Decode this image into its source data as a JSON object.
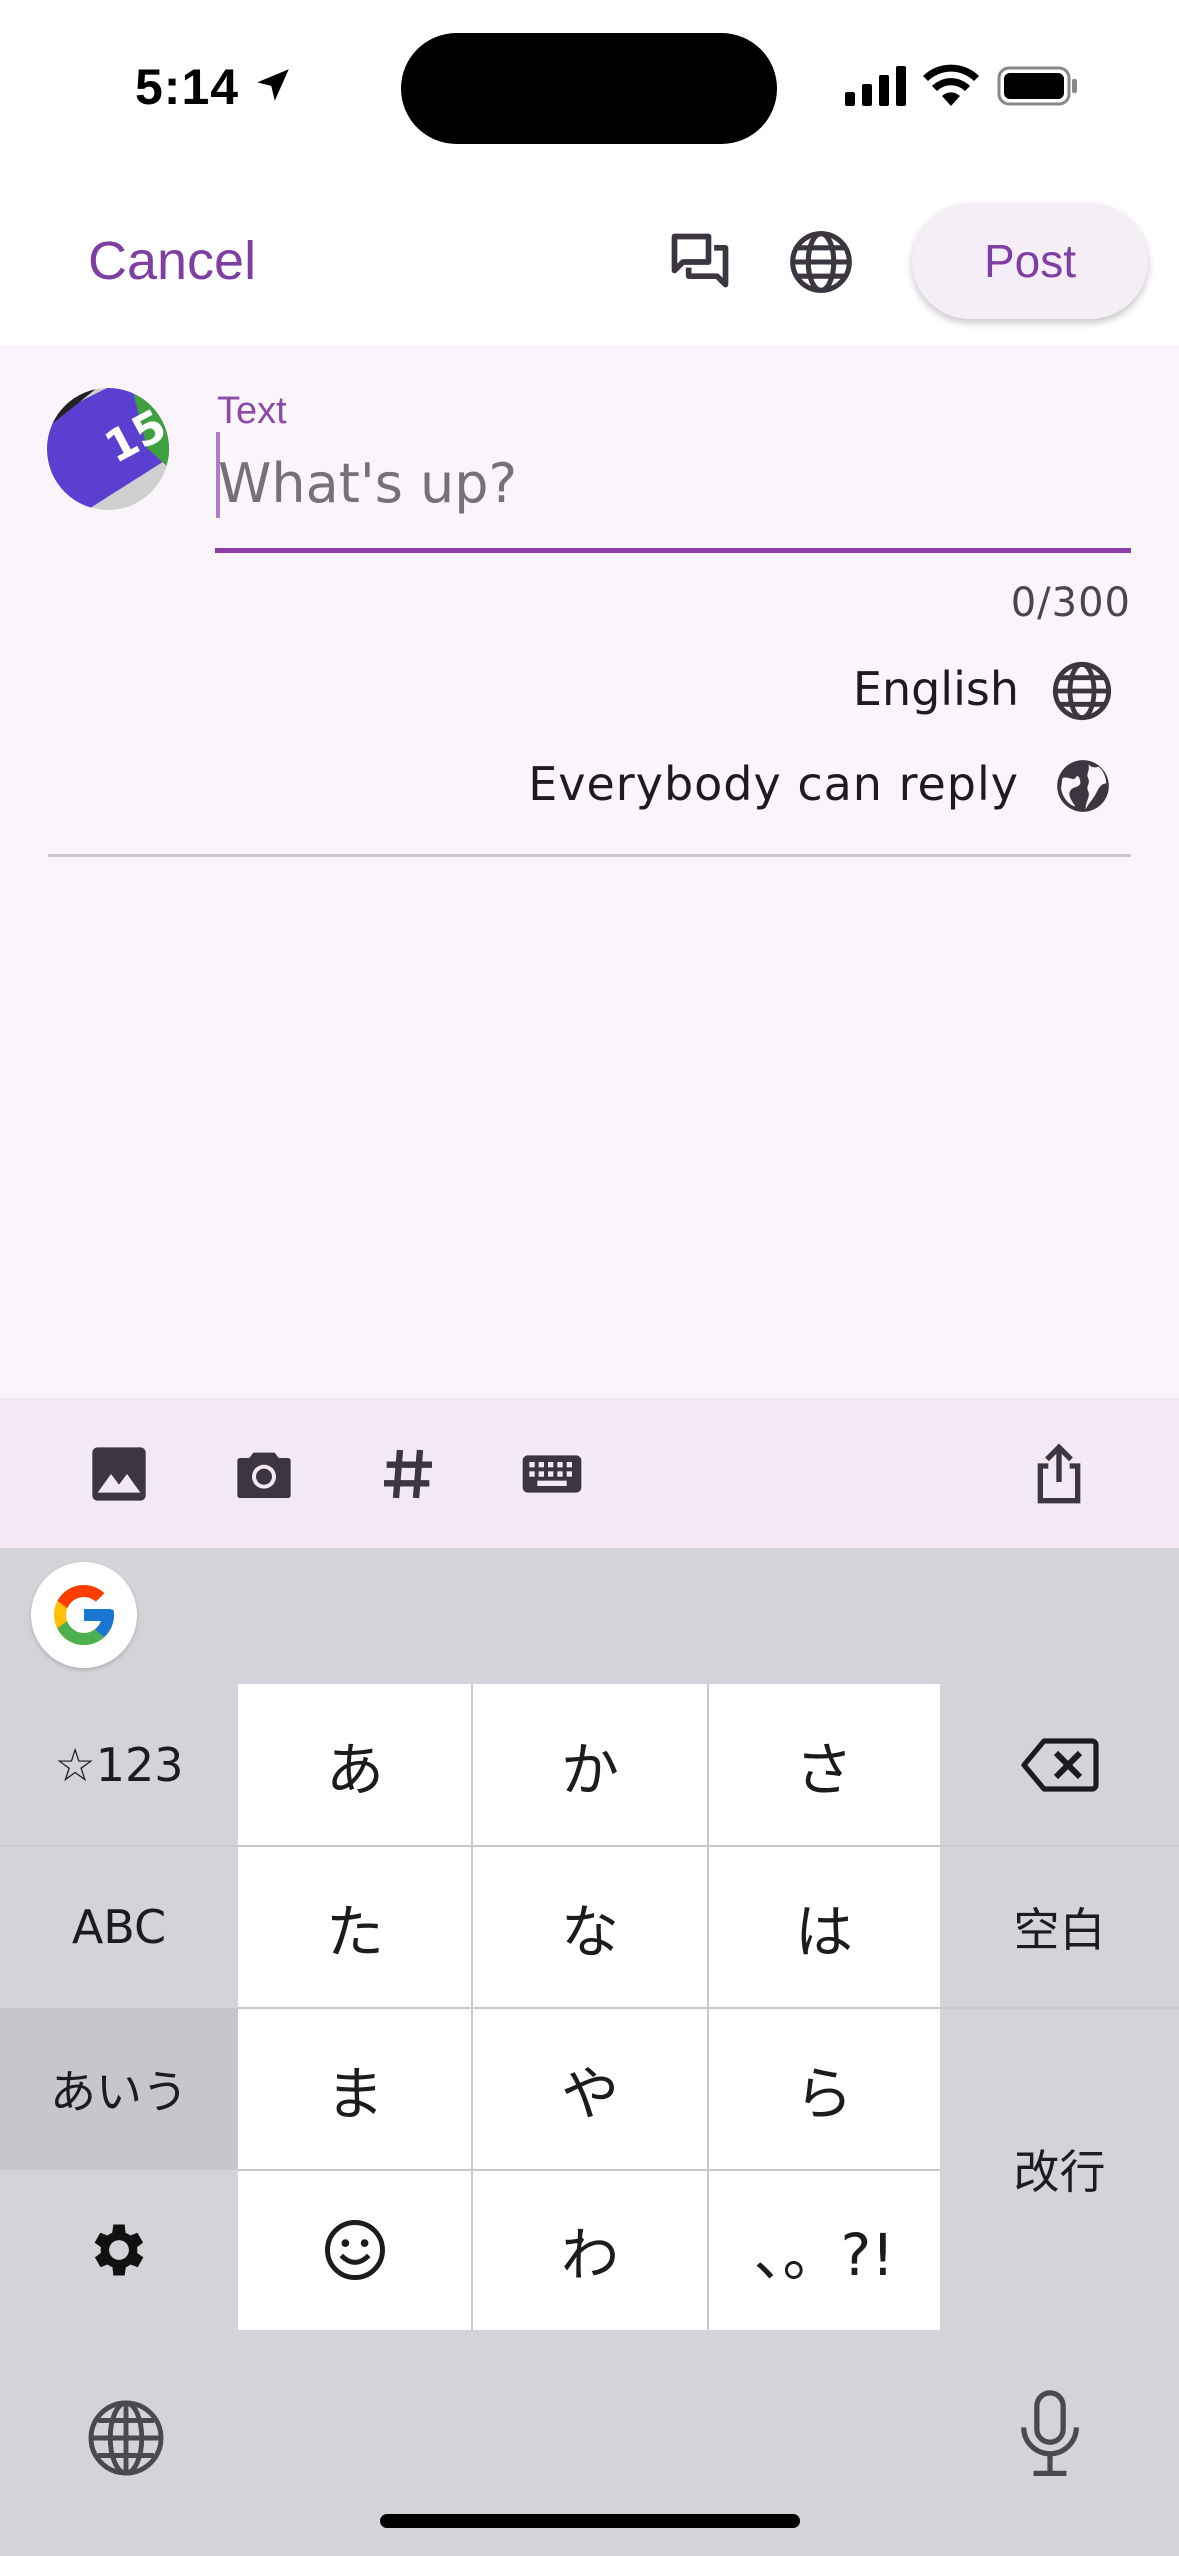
{
  "status_bar": {
    "time": "5:14"
  },
  "app_bar": {
    "cancel_label": "Cancel",
    "post_label": "Post",
    "accent_color": "#7e3fa3"
  },
  "compose": {
    "field_label": "Text",
    "placeholder": "What's up?",
    "value": "",
    "counter": "0/300",
    "language": "English",
    "reply_setting": "Everybody can reply"
  },
  "toolbar": {
    "icons": [
      "image-icon",
      "camera-icon",
      "hashtag-icon",
      "keyboard-icon",
      "share-icon"
    ]
  },
  "keyboard": {
    "row1": {
      "left": "☆123",
      "k1": "あ",
      "k2": "か",
      "k3": "さ",
      "right": "backspace-icon"
    },
    "row2": {
      "left": "ABC",
      "k1": "た",
      "k2": "な",
      "k3": "は",
      "right": "空白"
    },
    "row3": {
      "left": "あいう",
      "k1": "ま",
      "k2": "や",
      "k3": "ら"
    },
    "row4": {
      "left": "gear-icon",
      "k1": "smiley-icon",
      "k2": "わ",
      "k3": "、。?!"
    },
    "return_label": "改行"
  }
}
